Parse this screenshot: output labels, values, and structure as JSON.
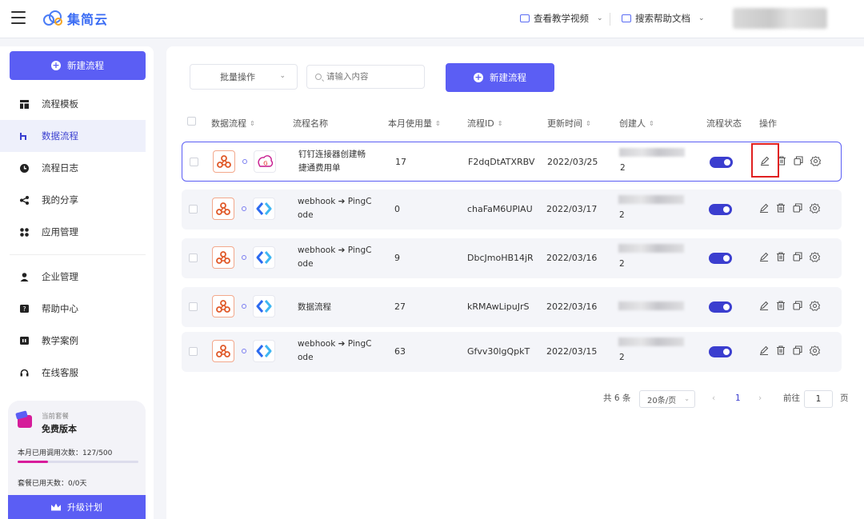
{
  "header": {
    "app_name": "集简云",
    "tutorial_link": "查看教学视频",
    "help_search_link": "搜索帮助文档"
  },
  "sidebar": {
    "new_flow_label": "新建流程",
    "items": [
      {
        "label": "流程模板",
        "icon": "template-icon"
      },
      {
        "label": "数据流程",
        "icon": "flow-icon",
        "active": true
      },
      {
        "label": "流程日志",
        "icon": "log-icon"
      },
      {
        "label": "我的分享",
        "icon": "share-icon"
      },
      {
        "label": "应用管理",
        "icon": "apps-icon"
      },
      {
        "label": "企业管理",
        "icon": "user-icon"
      },
      {
        "label": "帮助中心",
        "icon": "help-icon"
      },
      {
        "label": "教学案例",
        "icon": "case-icon"
      },
      {
        "label": "在线客服",
        "icon": "headset-icon"
      }
    ],
    "plan": {
      "caption": "当前套餐",
      "name": "免费版本",
      "calls_label": "本月已用调用次数：127/500",
      "calls_used_fraction": 0.254,
      "days_label": "套餐已用天数：0/0天",
      "upgrade_label": "升级计划"
    }
  },
  "toolbar": {
    "batch_label": "批量操作",
    "search_placeholder": "请输入内容",
    "new_flow_label": "新建流程"
  },
  "table": {
    "columns": [
      "数据流程",
      "流程名称",
      "本月使用量",
      "流程ID",
      "更新时间",
      "创建人",
      "流程状态",
      "操作"
    ],
    "rows": [
      {
        "name_line1": "钉钉连接器创建畅",
        "name_line2": "捷通费用单",
        "usage": "17",
        "flow_id": "F2dqDtATXRBV",
        "updated": "2022/03/25",
        "creator_suffix": "2",
        "enabled": true,
        "target_app": "dingtalk"
      },
      {
        "name_line1": "webhook ➔ PingC",
        "name_line2": "ode",
        "usage": "0",
        "flow_id": "chaFaM6UPlAU",
        "updated": "2022/03/17",
        "creator_suffix": "2",
        "enabled": true,
        "target_app": "pingcode"
      },
      {
        "name_line1": "webhook ➔ PingC",
        "name_line2": "ode",
        "usage": "9",
        "flow_id": "DbcJmoHB14jR",
        "updated": "2022/03/16",
        "creator_suffix": "2",
        "enabled": true,
        "target_app": "pingcode"
      },
      {
        "name_line1": "数据流程",
        "name_line2": "",
        "usage": "27",
        "flow_id": "kRMAwLipuJrS",
        "updated": "2022/03/16",
        "creator_suffix": "",
        "enabled": true,
        "target_app": "pingcode"
      },
      {
        "name_line1": "webhook ➔ PingC",
        "name_line2": "ode",
        "usage": "63",
        "flow_id": "Gfvv30lgQpkT",
        "updated": "2022/03/15",
        "creator_suffix": "2",
        "enabled": true,
        "target_app": "pingcode"
      }
    ]
  },
  "pagination": {
    "total_label": "共 6 条",
    "page_size_label": "20条/页",
    "current_page": "1",
    "goto_label": "前往",
    "goto_value": "1",
    "page_suffix": "页"
  },
  "colors": {
    "accent": "#5b5ef4",
    "toggle_on": "#3b3ecf",
    "highlight": "#e02020"
  }
}
